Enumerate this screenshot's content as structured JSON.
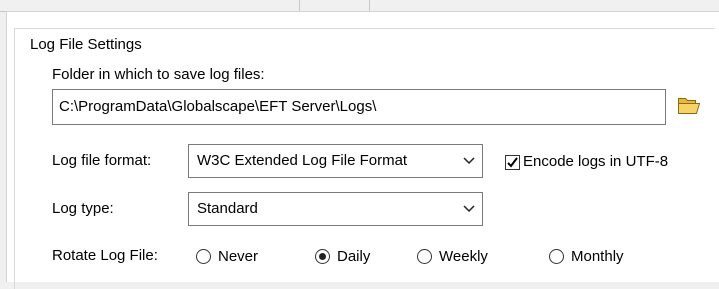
{
  "group": {
    "title": "Log File Settings"
  },
  "folder": {
    "label": "Folder in which to save log files:",
    "path": "C:\\ProgramData\\Globalscape\\EFT Server\\Logs\\"
  },
  "format": {
    "label": "Log file format:",
    "selected": "W3C Extended Log File Format"
  },
  "utf8": {
    "label": "Encode logs in UTF-8",
    "checked": true
  },
  "log_type": {
    "label": "Log type:",
    "selected": "Standard"
  },
  "rotate": {
    "label": "Rotate Log File:",
    "options": [
      "Never",
      "Daily",
      "Weekly",
      "Monthly"
    ],
    "selected": "Daily"
  },
  "icons": {
    "folder": "folder-open-icon",
    "chevron": "chevron-down-icon"
  },
  "colors": {
    "folder": "#e8b935",
    "border": "#7a7a7a"
  }
}
